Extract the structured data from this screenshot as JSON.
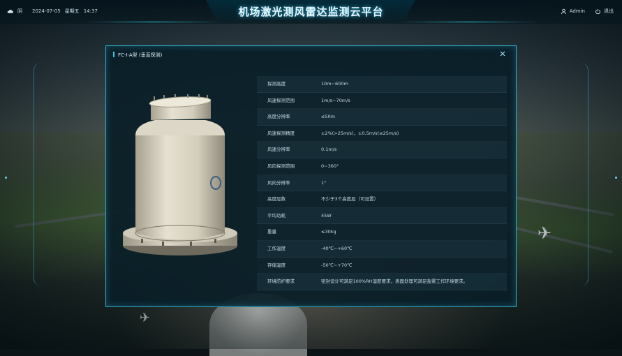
{
  "header": {
    "app_title": "机场激光测风雷达监测云平台",
    "weather_label": "阴",
    "datetime": "2024-07-05",
    "weekday": "星期五",
    "time": "14:37",
    "user_label": "Admin",
    "logout_label": "退出"
  },
  "modal": {
    "title": "FC-I-A型 (垂直探测)",
    "specs": [
      {
        "label": "探测高度",
        "value": "10m~600m"
      },
      {
        "label": "风速探测范围",
        "value": "1m/s~70m/s"
      },
      {
        "label": "高度分辨率",
        "value": "≤50m"
      },
      {
        "label": "风速探测精度",
        "value": "±2%(>25m/s)，±0.5m/s(≤25m/s)"
      },
      {
        "label": "风速分辨率",
        "value": "0.1m/s"
      },
      {
        "label": "风向探测范围",
        "value": "0~360°"
      },
      {
        "label": "风向分辨率",
        "value": "1°"
      },
      {
        "label": "高度层数",
        "value": "不少于3个高度层（可设置）"
      },
      {
        "label": "平均功耗",
        "value": "45W"
      },
      {
        "label": "重量",
        "value": "≤30kg"
      },
      {
        "label": "工作温度",
        "value": "-40℃~+60℃"
      },
      {
        "label": "存储温度",
        "value": "-50℃~+70℃"
      },
      {
        "label": "环境防护要求",
        "value": "密封设计可满足100%RH湿度要求，表面处理可满足盐雾工作环境要求。"
      }
    ]
  },
  "colors": {
    "accent": "#32c8e8",
    "panel_bg": "#0a1e28",
    "device_body": "#d9d4c4"
  },
  "icons": {
    "weather": "cloud-icon",
    "user": "user-icon",
    "logout": "power-icon",
    "close": "close-icon"
  }
}
